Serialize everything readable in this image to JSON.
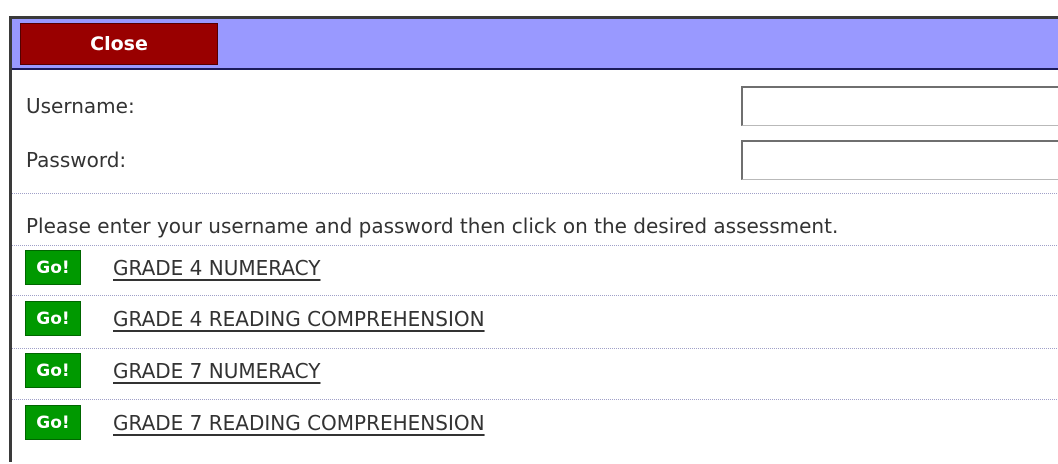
{
  "header": {
    "close_label": "Close",
    "bar_color": "#9999ff",
    "close_color": "#990000"
  },
  "login": {
    "username_label": "Username:",
    "username_value": "",
    "password_label": "Password:",
    "password_value": ""
  },
  "instructions": "Please enter your username and password then click on the desired assessment.",
  "assessments": [
    {
      "go_label": "Go!",
      "title": "GRADE 4 NUMERACY"
    },
    {
      "go_label": "Go!",
      "title": "GRADE 4 READING COMPREHENSION"
    },
    {
      "go_label": "Go!",
      "title": "GRADE 7 NUMERACY"
    },
    {
      "go_label": "Go!",
      "title": "GRADE 7 READING COMPREHENSION"
    }
  ],
  "go_color": "#009900"
}
